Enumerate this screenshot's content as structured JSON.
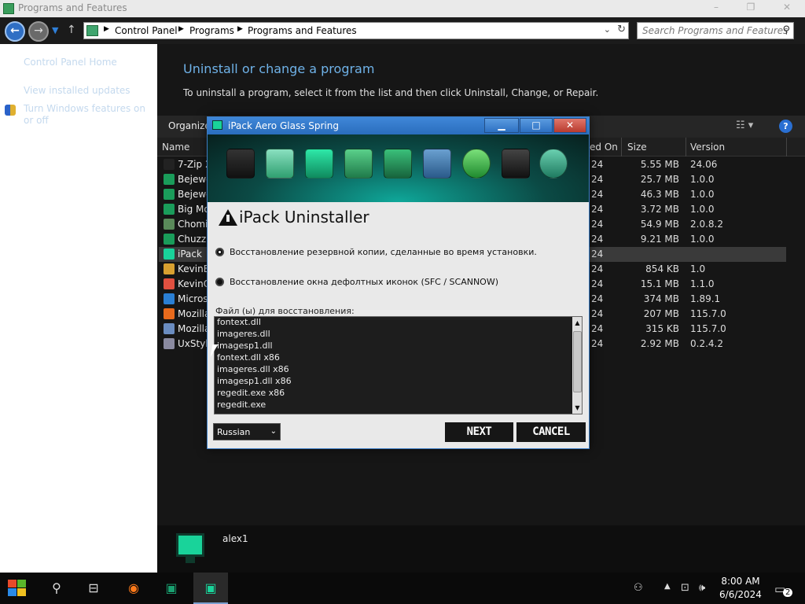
{
  "window": {
    "title": "Programs and Features",
    "controls": {
      "minimize": "–",
      "restore": "❐",
      "close": "✕"
    }
  },
  "navbar": {
    "breadcrumbs": [
      "Control Panel",
      "Programs",
      "Programs and Features"
    ],
    "search_placeholder": "Search Programs and Features"
  },
  "left_pane": {
    "links": [
      "Control Panel Home",
      "View installed updates",
      "Turn Windows features on or off"
    ]
  },
  "main": {
    "heading": "Uninstall or change a program",
    "description": "To uninstall a program, select it from the list and then click Uninstall, Change, or Repair.",
    "organize": "Organize ▾",
    "columns": {
      "name": "Name",
      "installed_on": "ed On",
      "size": "Size",
      "version": "Version"
    },
    "programs": [
      {
        "name": "7-Zip 2",
        "date": "24",
        "size": "5.55 MB",
        "version": "24.06",
        "icon_color": "#222222"
      },
      {
        "name": "Bejewe",
        "date": "24",
        "size": "25.7 MB",
        "version": "1.0.0",
        "icon_color": "#1a9c5a"
      },
      {
        "name": "Bejewe",
        "date": "24",
        "size": "46.3 MB",
        "version": "1.0.0",
        "icon_color": "#1a9c5a"
      },
      {
        "name": "Big Mo",
        "date": "24",
        "size": "3.72 MB",
        "version": "1.0.0",
        "icon_color": "#1a9c5a"
      },
      {
        "name": "Chomi",
        "date": "24",
        "size": "54.9 MB",
        "version": "2.0.8.2",
        "icon_color": "#5a8a5a"
      },
      {
        "name": "Chuzzl",
        "date": "24",
        "size": "9.21 MB",
        "version": "1.0.0",
        "icon_color": "#1a9c5a"
      },
      {
        "name": "iPack",
        "date": "24",
        "size": "",
        "version": "",
        "icon_color": "#19d39a"
      },
      {
        "name": "KevinB",
        "date": "24",
        "size": "854 KB",
        "version": "1.0",
        "icon_color": "#d8a030"
      },
      {
        "name": "KevinO",
        "date": "24",
        "size": "15.1 MB",
        "version": "1.1.0",
        "icon_color": "#e05040"
      },
      {
        "name": "Micros",
        "date": "24",
        "size": "374 MB",
        "version": "1.89.1",
        "icon_color": "#2a7fd4"
      },
      {
        "name": "Mozilla",
        "date": "24",
        "size": "207 MB",
        "version": "115.7.0",
        "icon_color": "#e86a1c"
      },
      {
        "name": "Mozilla",
        "date": "24",
        "size": "315 KB",
        "version": "115.7.0",
        "icon_color": "#6a8cc0"
      },
      {
        "name": "UxStyle",
        "date": "24",
        "size": "2.92 MB",
        "version": "0.2.4.2",
        "icon_color": "#8a8aa0"
      }
    ]
  },
  "details": {
    "user": "alex1"
  },
  "dialog": {
    "title": "iPack  Aero Glass Spring",
    "heading": "iPack Uninstaller",
    "option_backup": "Восстановление резервной копии, сделанные во время установки.",
    "option_sfc": "Восстановление окна дефолтных иконок (SFC / SCANNOW)",
    "files_label": "Файл (ы) для восстановления:",
    "files": [
      "fontext.dll",
      "imageres.dll",
      "imagesp1.dll",
      "fontext.dll x86",
      "imageres.dll x86",
      "imagesp1.dll x86",
      "regedit.exe x86",
      "regedit.exe"
    ],
    "language": "Russian",
    "next": "NEXT",
    "cancel": "CANCEL",
    "banner_icons": [
      "calculator-icon",
      "recycle-bin-icon",
      "monitor-icon",
      "binder-icon",
      "user-icon",
      "network-icon",
      "checkmark-icon",
      "joystick-icon",
      "magnifier-icon"
    ]
  },
  "taskbar": {
    "time": "8:00 AM",
    "date": "6/6/2024",
    "notification_count": "2"
  }
}
